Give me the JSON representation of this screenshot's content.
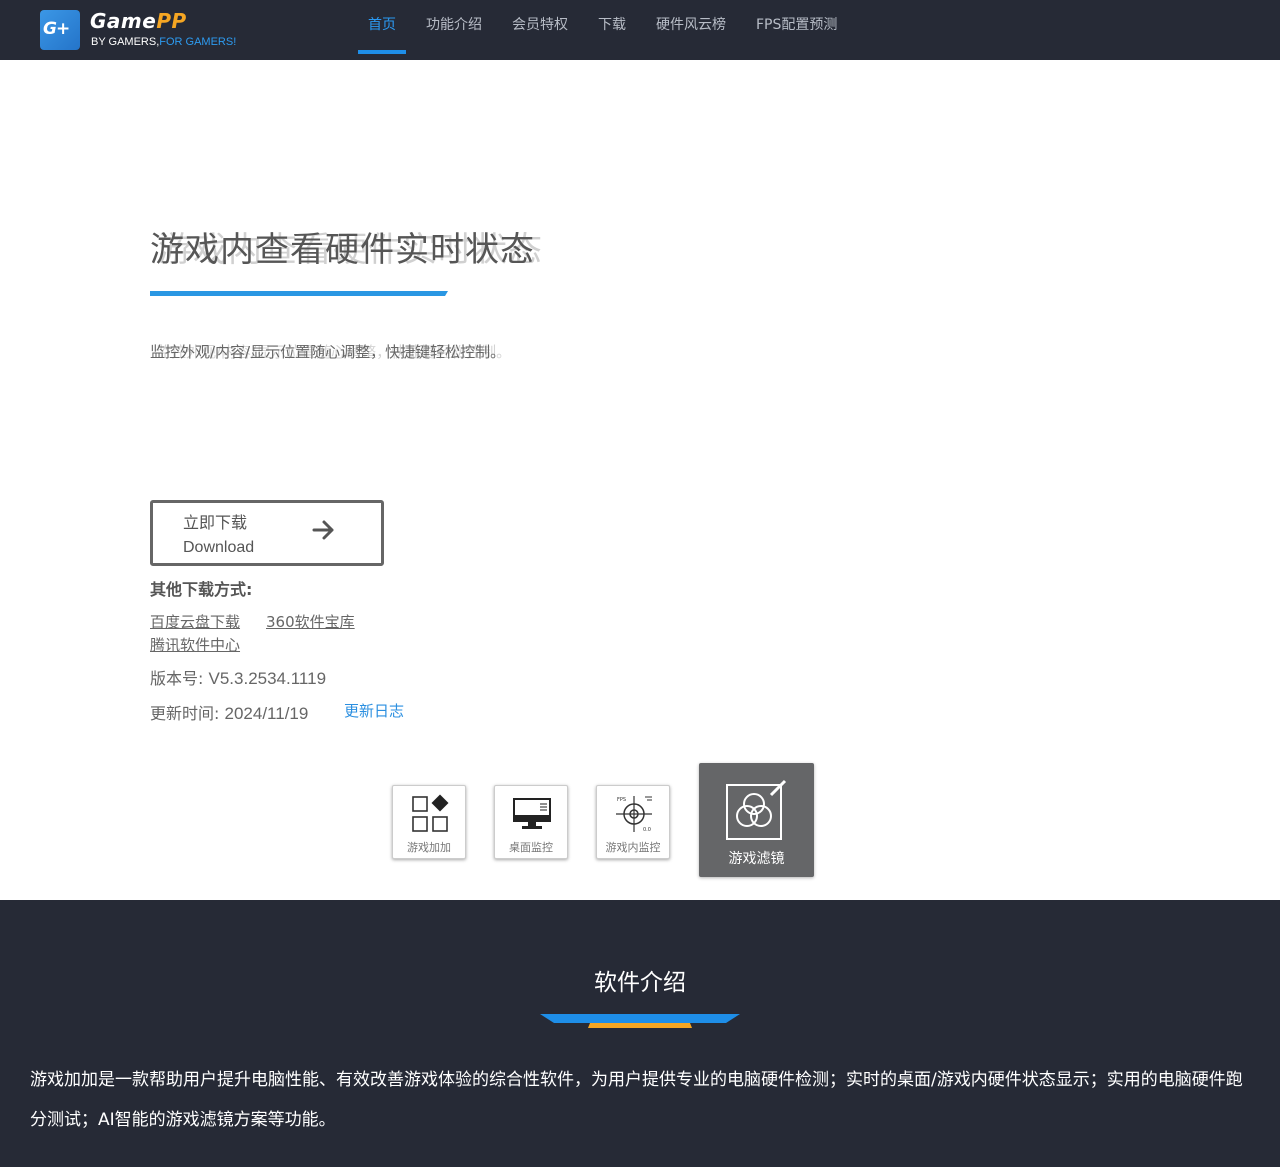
{
  "nav": {
    "logo": {
      "icon_text": "G+",
      "name_part1": "Game",
      "name_part2": "PP",
      "slogan_part1": "BY GAMERS,",
      "slogan_part2": "FOR GAMERS!"
    },
    "items": [
      {
        "label": "首页",
        "active": true
      },
      {
        "label": "功能介绍"
      },
      {
        "label": "会员特权"
      },
      {
        "label": "下载"
      },
      {
        "label": "硬件风云榜"
      },
      {
        "label": "FPS配置预测"
      }
    ]
  },
  "hero": {
    "title": "游戏内查看硬件实时状态",
    "description": "监控外观/内容/显示位置随心调整，快捷键轻松控制。",
    "download_button": {
      "label_cn": "立即下载",
      "label_en": "Download",
      "icon": "arrow-right-icon"
    },
    "other_download_title": "其他下载方式:",
    "other_links": [
      "百度云盘下载",
      "360软件宝库",
      "腾讯软件中心"
    ],
    "version_label": "版本号:",
    "version_value": "V5.3.2534.1119",
    "update_label": "更新时间:",
    "update_value": "2024/11/19",
    "changelog_link": "更新日志"
  },
  "feature_tabs": [
    {
      "label": "游戏加加",
      "icon": "apps-grid-icon",
      "active": false
    },
    {
      "label": "桌面监控",
      "icon": "monitor-icon",
      "active": false
    },
    {
      "label": "游戏内监控",
      "icon": "crosshair-fps-icon",
      "active": false,
      "icon_text_fps": "FPS",
      "icon_text_value": "0.0"
    },
    {
      "label": "游戏滤镜",
      "icon": "color-filter-icon",
      "active": true
    }
  ],
  "intro": {
    "title": "软件介绍",
    "text": "游戏加加是一款帮助用户提升电脑性能、有效改善游戏体验的综合性软件，为用户提供专业的电脑硬件检测；实时的桌面/游戏内硬件状态显示；实用的电脑硬件跑分测试；AI智能的游戏滤镜方案等功能。"
  },
  "colors": {
    "nav_bg": "#262a36",
    "accent_blue": "#2b9af3",
    "accent_orange": "#f5a623",
    "active_tab_bg": "#656668"
  }
}
